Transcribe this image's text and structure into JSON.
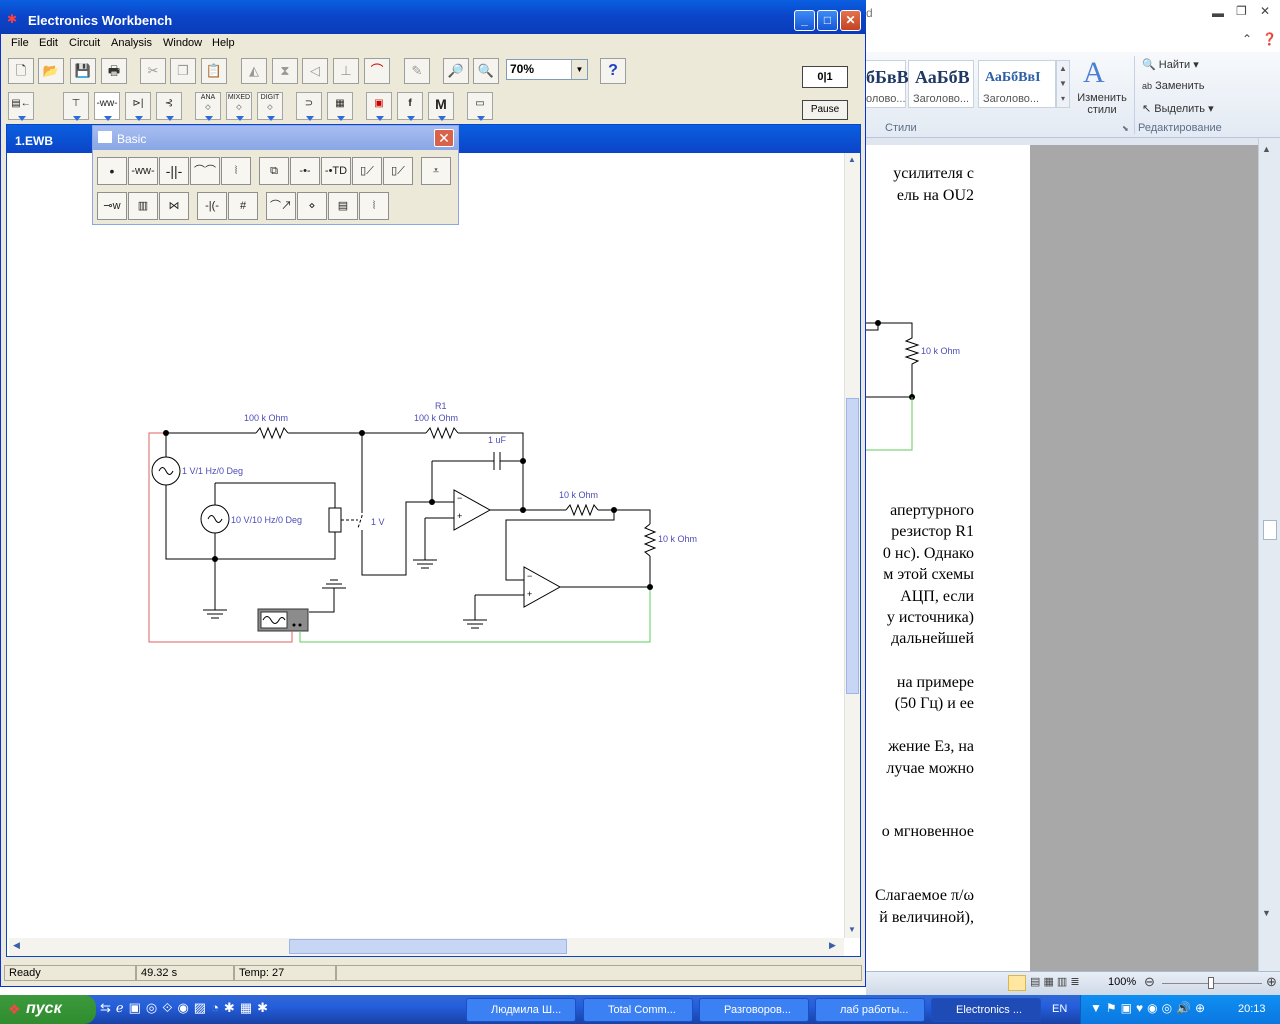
{
  "word": {
    "title_fragment": "d",
    "styles": [
      {
        "sample": "АаБбВ",
        "name": "Заголово..."
      },
      {
        "sample": "АаБбВвІ",
        "name": "Заголово..."
      }
    ],
    "styles_first_partial": {
      "sample": "бБвВ",
      "name": "олово..."
    },
    "change_styles": "Изменить стили",
    "styles_section": "Стили",
    "find": "Найти",
    "replace": "Заменить",
    "select": "Выделить",
    "editing_section": "Редактирование",
    "zoom": "100%",
    "text_lines": [
      "усилителя с",
      "ель на OU2",
      "апертурного",
      "резистор R1",
      "0 нс). Однако",
      "м этой схемы",
      "АЦП, если",
      "у источника)",
      "дальнейшей",
      "на примере",
      "(50 Гц) и ее",
      "жение Eз, на",
      "лучае можно",
      "о мгновенное",
      "Слагаемое π/ω",
      "й величиной),"
    ],
    "circuit_label": "10 k Ohm"
  },
  "ewb": {
    "title": "Electronics Workbench",
    "menu": [
      "File",
      "Edit",
      "Circuit",
      "Analysis",
      "Window",
      "Help"
    ],
    "zoom_value": "70%",
    "help_label": "?",
    "pause_label": "Pause",
    "power_label": "0|1",
    "child_title": "1.EWB",
    "palette_title": "Basic",
    "status": {
      "ready": "Ready",
      "time": "49.32 s",
      "temp": "Temp:  27"
    },
    "bin_labels": [
      "ANA",
      "MIXED",
      "DIGIT",
      "f",
      "M"
    ]
  },
  "circuit": {
    "labels": {
      "r_top": "100 k Ohm",
      "r1_name": "R1",
      "r1_val": "100 k Ohm",
      "cap": "1 uF",
      "src1": "1 V/1 Hz/0 Deg",
      "src2": "10 V/10 Hz/0 Deg",
      "switch": "1 V",
      "r_mid": "10 k Ohm",
      "r_right": "10 k Ohm"
    }
  },
  "taskbar": {
    "start": "пуск",
    "tasks": [
      "Людмила Ш...",
      "Total Comm...",
      "Разговоров...",
      "лаб работы...",
      "Electronics ..."
    ],
    "lang": "EN",
    "clock": "20:13"
  }
}
